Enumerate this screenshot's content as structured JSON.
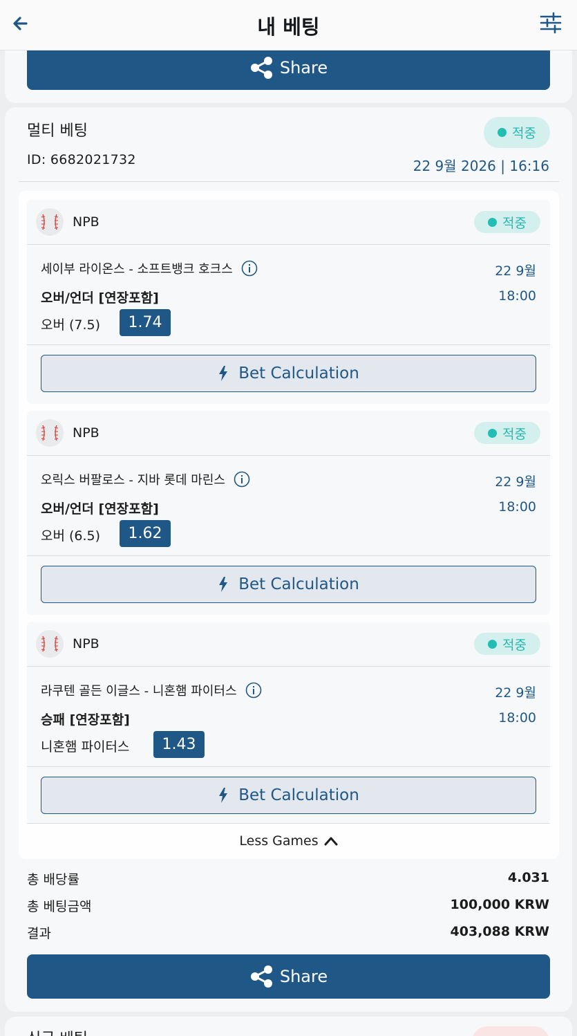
{
  "header": {
    "title": "내 베팅",
    "back_icon": "arrow-left-icon",
    "filter_icon": "sliders-icon"
  },
  "top_share": {
    "label": "Share",
    "icon": "share-icon"
  },
  "slip": {
    "title": "멀티 베팅",
    "status": "적중",
    "id_text": "ID: 6682021732",
    "datetime": "22 9월 2026 | 16:16",
    "games": [
      {
        "league": "NPB",
        "status": "적중",
        "match": "세이부 라이온스 - 소프트뱅크 호크스",
        "date": "22 9월",
        "time": "18:00",
        "market": "오버/언더 [연장포함]",
        "selection": "오버 (7.5)",
        "odds": "1.74",
        "calc_label": "Bet Calculation"
      },
      {
        "league": "NPB",
        "status": "적중",
        "match": "오릭스 버팔로스 - 지바 롯데 마린스",
        "date": "22 9월",
        "time": "18:00",
        "market": "오버/언더 [연장포함]",
        "selection": "오버 (6.5)",
        "odds": "1.62",
        "calc_label": "Bet Calculation"
      },
      {
        "league": "NPB",
        "status": "적중",
        "match": "라쿠텐 골든 이글스 - 니혼햄 파이터스",
        "date": "22 9월",
        "time": "18:00",
        "market": "승패 [연장포함]",
        "selection": "니혼햄 파이터스",
        "odds": "1.43",
        "calc_label": "Bet Calculation"
      }
    ],
    "less_games_label": "Less Games",
    "summary": {
      "total_odds_label": "총 배당률",
      "total_odds_value": "4.031",
      "stake_label": "총 베팅금액",
      "stake_value": "100,000 KRW",
      "result_label": "결과",
      "result_value": "403,088 KRW"
    },
    "share_label": "Share"
  },
  "next_card": {
    "title": "싱글 베팅"
  },
  "colors": {
    "primary": "#1f5787",
    "win_text": "#29b7b0",
    "win_bg": "#d4f0ee"
  }
}
